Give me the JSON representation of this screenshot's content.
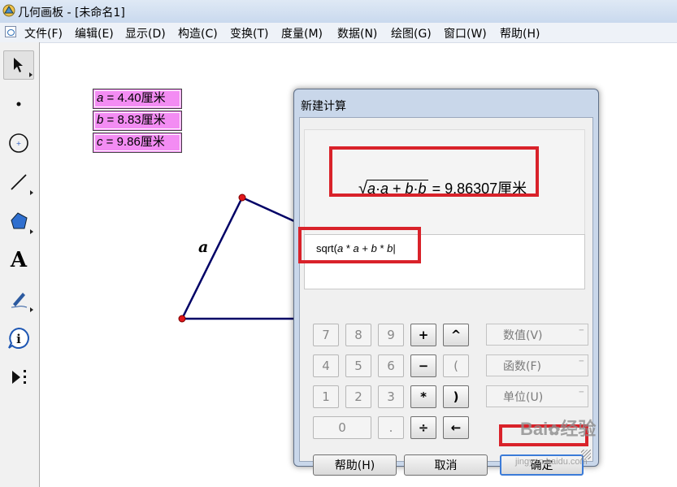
{
  "window": {
    "title": "几何画板 - [未命名1]"
  },
  "menus": [
    {
      "label": "文件(F)"
    },
    {
      "label": "编辑(E)"
    },
    {
      "label": "显示(D)"
    },
    {
      "label": "构造(C)"
    },
    {
      "label": "变换(T)"
    },
    {
      "label": "度量(M)"
    },
    {
      "label": "数据(N)"
    },
    {
      "label": "绘图(G)"
    },
    {
      "label": "窗口(W)"
    },
    {
      "label": "帮助(H)"
    }
  ],
  "tools": [
    {
      "icon": "arrow-select-icon",
      "active": true
    },
    {
      "icon": "point-icon"
    },
    {
      "icon": "compass-icon"
    },
    {
      "icon": "line-segment-icon"
    },
    {
      "icon": "polygon-icon"
    },
    {
      "icon": "text-icon",
      "glyph": "A"
    },
    {
      "icon": "marker-pen-icon"
    },
    {
      "icon": "info-icon",
      "glyph": "i"
    },
    {
      "icon": "custom-tool-icon"
    }
  ],
  "measurements": [
    {
      "var": "a",
      "text": " = 4.40厘米"
    },
    {
      "var": "b",
      "text": " = 8.83厘米"
    },
    {
      "var": "c",
      "text": " = 9.86厘米"
    }
  ],
  "sketch": {
    "side_label": "a"
  },
  "dialog": {
    "title": "新建计算",
    "preview": {
      "radicand_parts": [
        "a",
        "·",
        "a",
        " + ",
        "b",
        "·",
        "b"
      ],
      "result": " = 9.86307厘米"
    },
    "expression": {
      "prefix": "sqrt(",
      "parts": [
        "a",
        " * ",
        "a",
        " + ",
        "b",
        " * ",
        "b"
      ],
      "caret": "|"
    },
    "keypad": [
      {
        "label": "7"
      },
      {
        "label": "8"
      },
      {
        "label": "9"
      },
      {
        "label": "4"
      },
      {
        "label": "5"
      },
      {
        "label": "6"
      },
      {
        "label": "1"
      },
      {
        "label": "2"
      },
      {
        "label": "3"
      },
      {
        "label": "0"
      },
      {
        "label": "."
      }
    ],
    "operators": [
      "+",
      "^",
      "−",
      "(",
      "*",
      ")",
      "÷",
      "←"
    ],
    "side_buttons": [
      {
        "label": "数值(V)"
      },
      {
        "label": "函数(F)"
      },
      {
        "label": "单位(U)"
      }
    ],
    "buttons": {
      "help": "帮助(H)",
      "cancel": "取消",
      "ok": "确定"
    }
  },
  "watermark": {
    "brand": "Bai",
    "brand2": "经验",
    "url": "jingyan.baidu.com"
  },
  "colors": {
    "highlight_red": "#d9222a",
    "measure_bg": "#f38cf3",
    "line_navy": "#000066",
    "point_red": "#e0161b"
  }
}
